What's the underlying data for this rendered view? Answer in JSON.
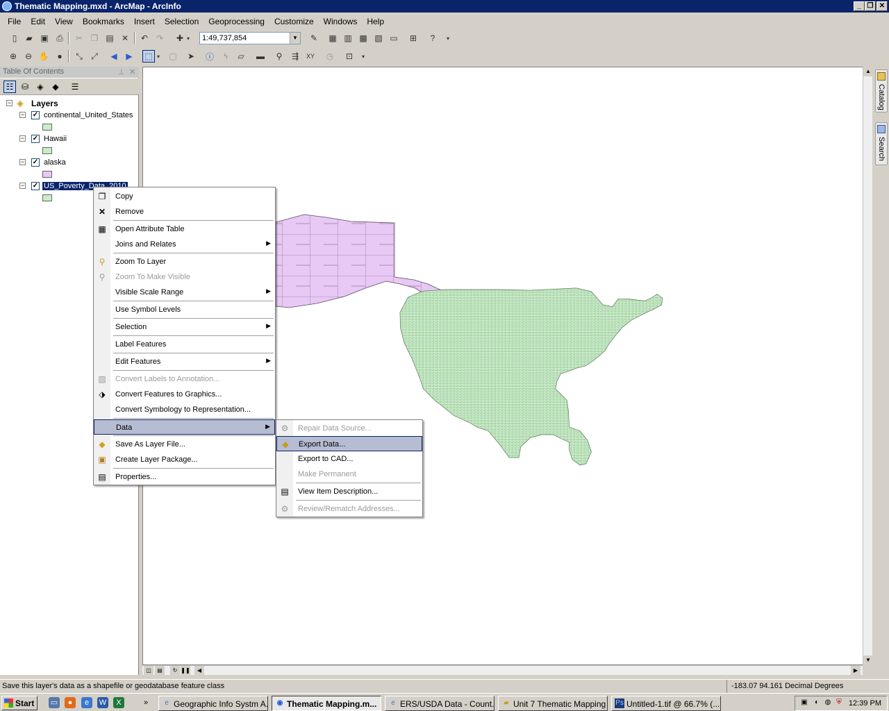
{
  "window": {
    "title": "Thematic Mapping.mxd - ArcMap - ArcInfo",
    "controls": {
      "minimize": "_",
      "restore": "❐",
      "close": "✕"
    }
  },
  "menubar": [
    "File",
    "Edit",
    "View",
    "Bookmarks",
    "Insert",
    "Selection",
    "Geoprocessing",
    "Customize",
    "Windows",
    "Help"
  ],
  "toolbar": {
    "scale": "1:49,737,854"
  },
  "toc": {
    "title": "Table Of Contents",
    "root": "Layers",
    "layers": [
      {
        "name": "continental_United_States",
        "checked": true,
        "color": "#c8eec8"
      },
      {
        "name": "Hawaii",
        "checked": true,
        "color": "#c8eec8"
      },
      {
        "name": "alaska",
        "checked": true,
        "color": "#e8c8f4"
      },
      {
        "name": "US_Poverty_Data_2010",
        "checked": true,
        "color": "#c8eec8",
        "selected": true
      }
    ]
  },
  "context_menu": {
    "items": [
      {
        "label": "Copy",
        "icon": "copy-icon"
      },
      {
        "label": "Remove",
        "icon": "remove-icon"
      },
      {
        "label": "Open Attribute Table",
        "icon": "table-icon"
      },
      {
        "label": "Joins and Relates",
        "submenu": true
      },
      {
        "label": "Zoom To Layer",
        "icon": "zoom-layer-icon"
      },
      {
        "label": "Zoom To Make Visible",
        "disabled": true
      },
      {
        "label": "Visible Scale Range",
        "submenu": true
      },
      {
        "label": "Use Symbol Levels"
      },
      {
        "label": "Selection",
        "submenu": true
      },
      {
        "label": "Label Features"
      },
      {
        "label": "Edit Features",
        "submenu": true
      },
      {
        "label": "Convert Labels to Annotation...",
        "disabled": true
      },
      {
        "label": "Convert Features to Graphics..."
      },
      {
        "label": "Convert Symbology to Representation..."
      },
      {
        "label": "Data",
        "submenu": true,
        "highlighted": true
      },
      {
        "label": "Save As Layer File..."
      },
      {
        "label": "Create Layer Package..."
      },
      {
        "label": "Properties..."
      }
    ]
  },
  "submenu": {
    "items": [
      {
        "label": "Repair Data Source...",
        "disabled": true
      },
      {
        "label": "Export Data...",
        "highlighted": true
      },
      {
        "label": "Export to CAD..."
      },
      {
        "label": "Make Permanent",
        "disabled": true
      },
      {
        "label": "View Item Description..."
      },
      {
        "label": "Review/Rematch Addresses...",
        "disabled": true
      }
    ]
  },
  "dock": {
    "catalog": "Catalog",
    "search": "Search"
  },
  "statusbar": {
    "message": "Save this layer's data as a shapefile or geodatabase feature class",
    "coords": "-183.07  94.161 Decimal Degrees"
  },
  "taskbar": {
    "start": "Start",
    "overflow": "»",
    "tasks": [
      {
        "label": "Geographic Info Systm A..."
      },
      {
        "label": "Thematic Mapping.m...",
        "active": true
      },
      {
        "label": "ERS/USDA Data - Count..."
      },
      {
        "label": "Unit 7 Thematic Mapping"
      },
      {
        "label": "Untitled-1.tif @ 66.7% (..."
      }
    ],
    "clock": "12:39 PM"
  }
}
